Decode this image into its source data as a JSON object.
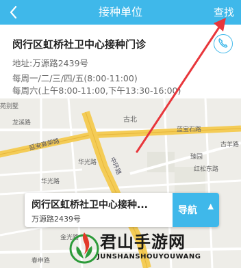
{
  "header": {
    "back_icon": "chevron-left-icon",
    "title": "接种单位",
    "search_label": "查找"
  },
  "clinic": {
    "name": "闵行区虹桥社卫中心接种门诊",
    "phone_icon": "phone-icon",
    "address": "地址:万源路2439号",
    "hours_weekday": "每周一/二/三/四/五(8:00-11:00)",
    "hours_saturday": "每周六(上午8:00-11:00,下午13:30-16:00)"
  },
  "map": {
    "labels": [
      "苑别墅",
      "龙溪路",
      "古北",
      "蓝宝石路",
      "古羊路",
      "臻园",
      "红松东路",
      "华光路",
      "华光路",
      "春申路",
      "金光路"
    ],
    "road_labels": [
      "延安高架路",
      "中环路"
    ]
  },
  "popup": {
    "name": "闵行区虹桥社卫中心接种...",
    "address": "万源路2439号",
    "nav_label": "导航",
    "caret_icon": "caret-up-icon"
  },
  "watermark": {
    "cn": "君山手游网",
    "en": "JUNSHANSHOUYOUWANG"
  },
  "colors": {
    "accent": "#3fb8ea",
    "annotation_arrow": "#e8363b"
  }
}
